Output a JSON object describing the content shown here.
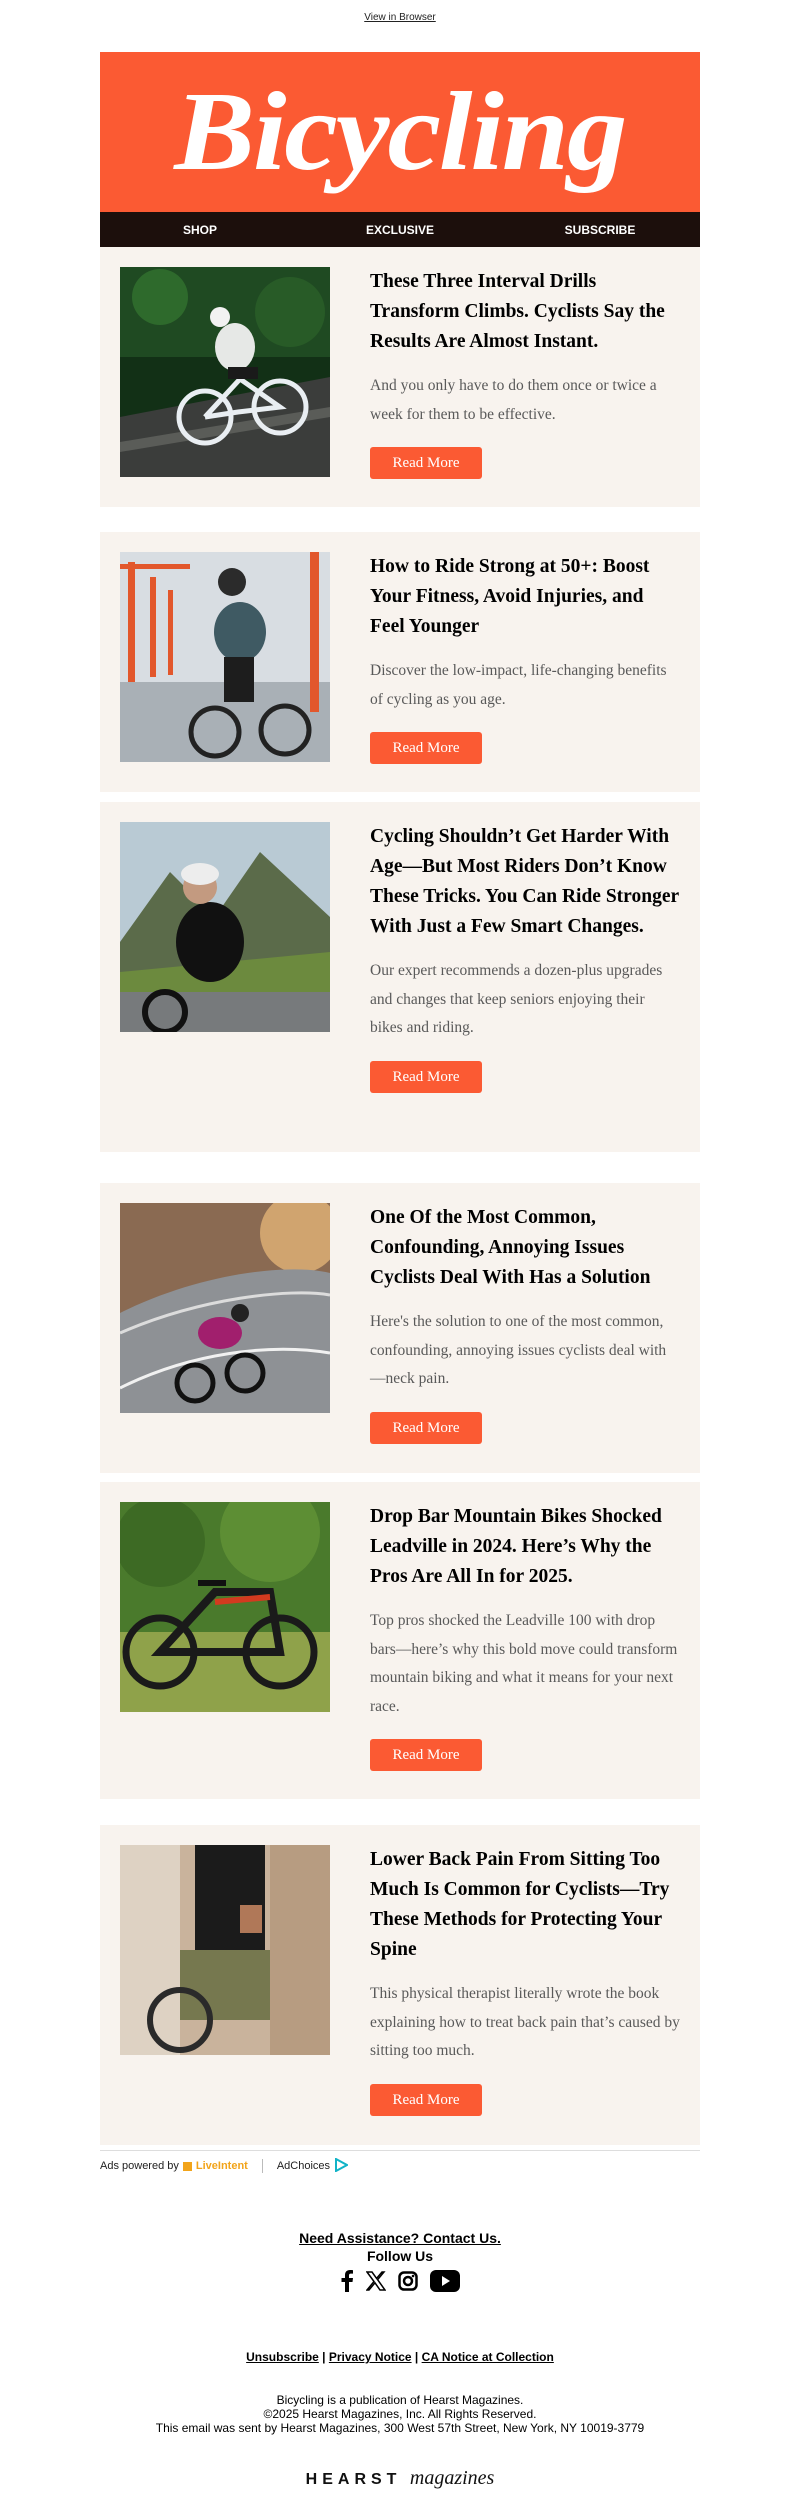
{
  "top_link": "View in Browser",
  "brand": {
    "logo_text": "Bicycling",
    "accent": "#fb5a33",
    "nav_bg": "#1c0f0c",
    "card_bg": "#f8f3ee"
  },
  "nav": [
    "SHOP",
    "EXCLUSIVE",
    "SUBSCRIBE"
  ],
  "articles": [
    {
      "title": "These Three Interval Drills Transform Climbs. Cyclists Say the Results Are Almost Instant.",
      "desc": "And you only have to do them once or twice a week for them to be effective.",
      "cta": "Read More",
      "image": "cyclist-climbing-photo"
    },
    {
      "title": "How to Ride Strong at 50+: Boost Your Fitness, Avoid Injuries, and Feel Younger",
      "desc": "Discover the low-impact, life-changing benefits of cycling as you age.",
      "cta": "Read More",
      "image": "cyclist-bridge-photo"
    },
    {
      "title": "Cycling Shouldn’t Get Harder With Age—But Most Riders Don’t Know These Tricks. You Can Ride Stronger With Just a Few Smart Changes.",
      "desc": "Our expert recommends a dozen-plus upgrades and changes that keep seniors enjoying their bikes and riding.",
      "cta": "Read More",
      "image": "older-cyclist-mountains-photo"
    },
    {
      "title": "One Of the Most Common, Confounding, Annoying Issues Cyclists Deal With Has a Solution",
      "desc": "Here's the solution to one of the most common, confounding, annoying issues cyclists deal with—neck pain.",
      "cta": "Read More",
      "image": "cyclist-road-curve-photo"
    },
    {
      "title": "Drop Bar Mountain Bikes Shocked Leadville in 2024. Here’s Why the Pros Are All In for 2025.",
      "desc": "Top pros shocked the Leadville 100 with drop bars—here’s why this bold move could transform mountain biking and what it means for your next race.",
      "cta": "Read More",
      "image": "mountain-bike-grass-photo"
    },
    {
      "title": "Lower Back Pain From Sitting Too Much Is Common for Cyclists—Try These Methods for Protecting Your Spine",
      "desc": "This physical therapist literally wrote the book explaining how to treat back pain that’s caused by sitting too much.",
      "cta": "Read More",
      "image": "cyclist-back-pain-photo"
    }
  ],
  "ads": {
    "powered_by": "Ads powered by",
    "liveintent": "LiveIntent",
    "adchoices": "AdChoices"
  },
  "footer": {
    "assistance": "Need Assistance? Contact Us.",
    "follow": "Follow Us",
    "social_icons": [
      "facebook-icon",
      "x-icon",
      "instagram-icon",
      "youtube-icon"
    ],
    "links": [
      "Unsubscribe",
      "Privacy Notice",
      "CA Notice at Collection"
    ],
    "line1": "Bicycling is a publication of Hearst Magazines.",
    "line2": "©2025 Hearst Magazines, Inc. All Rights Reserved.",
    "line3": "This email was sent by Hearst Magazines, 300 West 57th Street, New York, NY 10019-3779",
    "hearst_word": "HEARST",
    "hearst_mag": "magazines"
  }
}
